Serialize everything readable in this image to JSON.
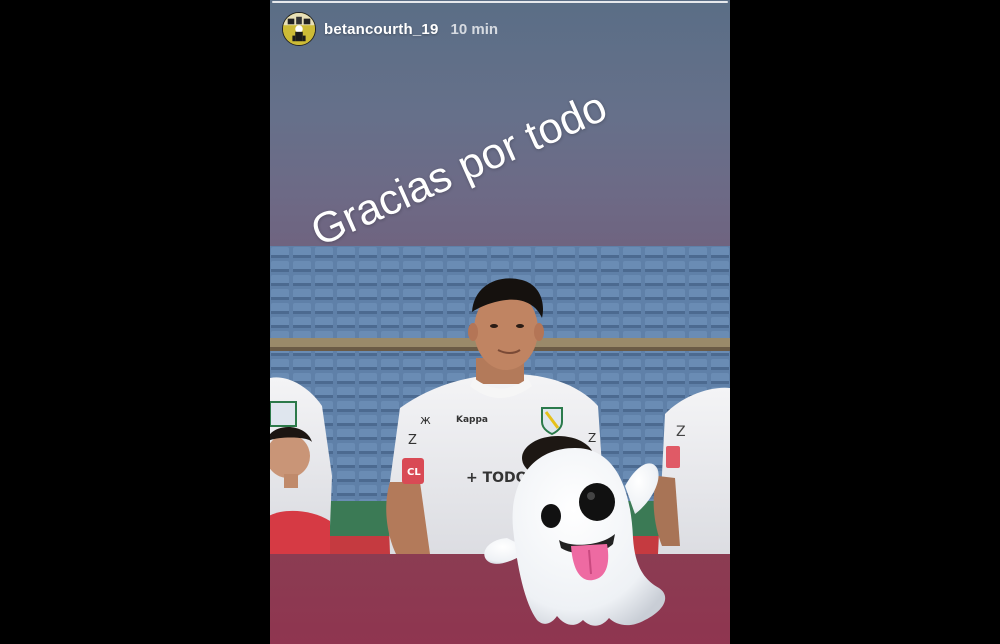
{
  "story": {
    "username": "betancourth_19",
    "timestamp": "10 min",
    "caption": "Gracias por todo"
  },
  "photo": {
    "subject": "football players lined up in stadium",
    "jersey_brand": "Kappa",
    "sponsor": "TODO",
    "patch": "CL"
  },
  "sticker": {
    "emoji": "ghost-tongue-out-emoji"
  },
  "colors": {
    "background": "#000000",
    "gradient_top": "#5a6e86",
    "gradient_bottom": "#8f3550",
    "stands_blue": "#5e7ea4"
  }
}
